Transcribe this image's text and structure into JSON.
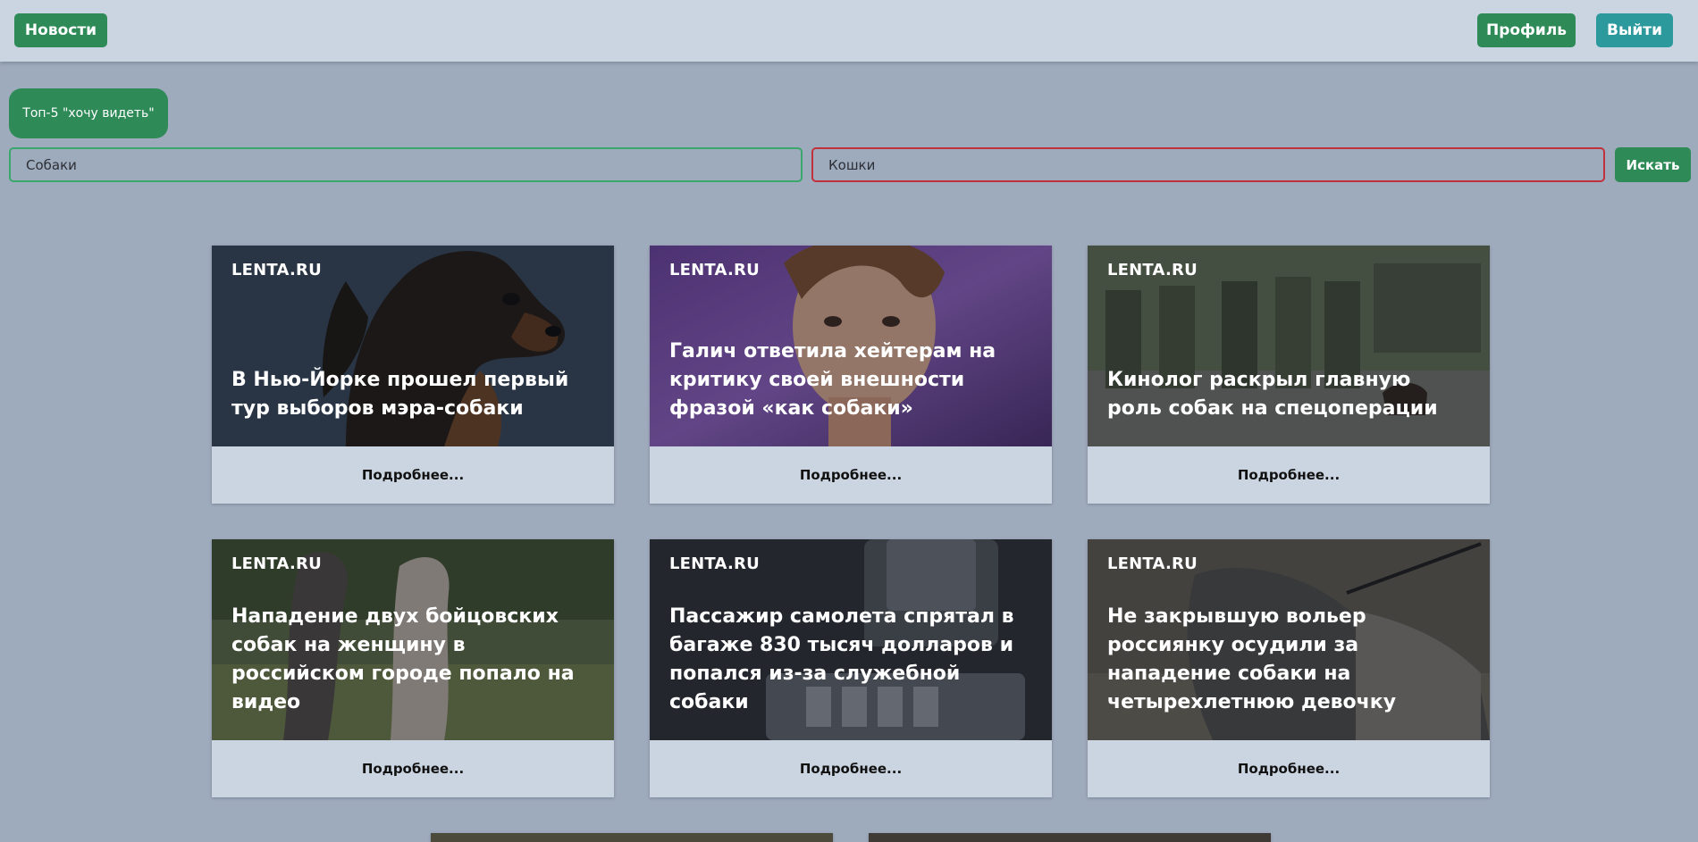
{
  "nav": {
    "news_label": "Новости",
    "profile_label": "Профиль",
    "logout_label": "Выйти"
  },
  "top5_label": "Топ-5 \"хочу видеть\"",
  "search": {
    "want_value": "Собаки",
    "block_value": "Кошки",
    "button_label": "Искать"
  },
  "colors": {
    "accent_green": "#2e8b57",
    "accent_teal": "#2c999c",
    "want_border": "#3aa76d",
    "block_border": "#c0313b"
  },
  "cards": [
    {
      "source": "LENTA.RU",
      "title": "В Нью-Йорке прошел первый тур выборов мэра-собаки",
      "more": "Подробнее..."
    },
    {
      "source": "LENTA.RU",
      "title": "Галич ответила хейтерам на критику своей внешности фразой «как собаки»",
      "more": "Подробнее..."
    },
    {
      "source": "LENTA.RU",
      "title": "Кинолог раскрыл главную роль собак на спецоперации",
      "more": "Подробнее..."
    },
    {
      "source": "LENTA.RU",
      "title": "Нападение двух бойцовских собак на женщину в российском городе попало на видео",
      "more": "Подробнее..."
    },
    {
      "source": "LENTA.RU",
      "title": "Пассажир самолета спрятал в багаже 830 тысяч долларов и попался из-за служебной собаки",
      "more": "Подробнее..."
    },
    {
      "source": "LENTA.RU",
      "title": "Не закрывшую вольер россиянку осудили за нападение собаки на четырехлетнюю девочку",
      "more": "Подробнее..."
    }
  ]
}
